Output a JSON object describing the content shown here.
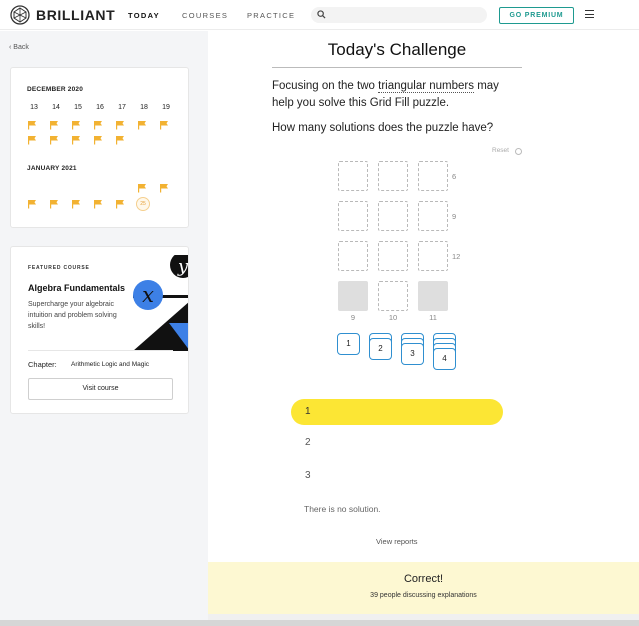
{
  "header": {
    "brand": "BRILLIANT",
    "nav": [
      {
        "label": "TODAY",
        "active": true
      },
      {
        "label": "COURSES",
        "active": false
      },
      {
        "label": "PRACTICE",
        "active": false
      }
    ],
    "search_placeholder": "",
    "premium_label": "GO PREMIUM"
  },
  "sidebar": {
    "back_label": "Back",
    "calendar": {
      "month1": "DECEMBER 2020",
      "days": [
        "13",
        "14",
        "15",
        "16",
        "17",
        "18",
        "19"
      ],
      "month2": "JANUARY 2021",
      "today_marker": "25",
      "flag_color": "#f2b232"
    },
    "featured": {
      "label": "FEATURED COURSE",
      "title": "Algebra Fundamentals",
      "description": "Supercharge your algebraic intuition and problem solving skills!",
      "chapter_label": "Chapter:",
      "chapter_name": "Arithmetic Logic and Magic",
      "visit_label": "Visit course"
    }
  },
  "main": {
    "title": "Today's Challenge",
    "prompt_before": "Focusing on the two ",
    "prompt_link": "triangular numbers",
    "prompt_after": " may help you solve this Grid Fill puzzle.",
    "question": "How many solutions does the puzzle have?",
    "reset_label": "Reset",
    "row_sums": [
      "6",
      "9",
      "12"
    ],
    "col_sums": [
      "9",
      "10",
      "11"
    ],
    "tiles": [
      "1",
      "2",
      "3",
      "4"
    ],
    "options": [
      "1",
      "2",
      "3",
      "There is no solution."
    ],
    "view_reports": "View reports",
    "result_title": "Correct!",
    "result_sub": "39 people discussing explanations",
    "accent_color": "#fce634",
    "tile_color": "#2f8fd0"
  }
}
